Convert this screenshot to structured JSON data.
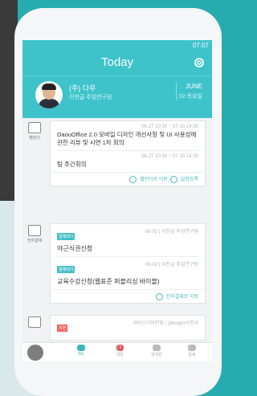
{
  "status": {
    "time": "07:07"
  },
  "header": {
    "title": "Today"
  },
  "profile": {
    "name": "(주) 다우",
    "dept": "이천급 주임연구원",
    "month": "JUNE",
    "day": "02 목요일"
  },
  "calendar": {
    "side_label": "캘린더",
    "events": [
      {
        "time": "06-27 10:30 ~ 07-15 14:30",
        "title": "DaouOffice 2.0 모바일 디자인 개선사항 및 UI 사용성에 관한 리뷰 및 시연 1차 회의"
      },
      {
        "time": "06-27 10:30 ~ 07-15 14:30",
        "title": "팀 주간회의"
      }
    ],
    "link_calendar": "캘린더로 이동",
    "link_add": "일정등록"
  },
  "approval": {
    "side_label": "전자결재",
    "items": [
      {
        "badge": "결재대기",
        "meta": "06-02 | 이천급 주임연구원",
        "title": "야근식권신청"
      },
      {
        "badge": "결재대기",
        "meta": "06-02 | 이천급 주임연구원",
        "title": "교육수강신청(웹표준 퍼블리싱 바이블)"
      }
    ],
    "link": "전자결재로 이동"
  },
  "works": {
    "badge": "지연",
    "meta": "서비스디자인팀 | (design)서천사"
  },
  "tabs": [
    {
      "label": "My"
    },
    {
      "label": "대화",
      "count": "6"
    },
    {
      "label": "임직원"
    },
    {
      "label": "알림"
    }
  ]
}
